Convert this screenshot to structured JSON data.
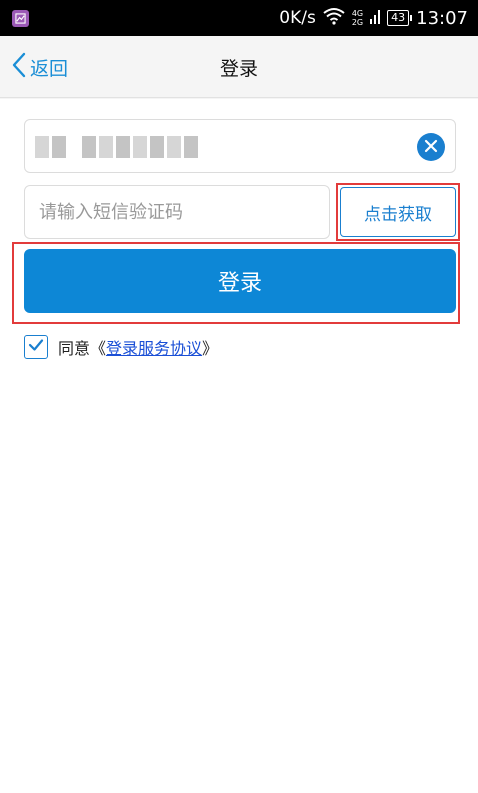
{
  "status_bar": {
    "net_speed": "0K/s",
    "net_type_top": "4G",
    "net_type_bottom": "2G",
    "battery": "43",
    "time": "13:07"
  },
  "header": {
    "back_label": "返回",
    "title": "登录"
  },
  "form": {
    "sms_placeholder": "请输入短信验证码",
    "get_code_label": "点击获取",
    "login_label": "登录",
    "agree_prefix": "同意《",
    "agreement_link": "登录服务协议",
    "agree_suffix": "》",
    "agree_checked": true
  },
  "colors": {
    "accent": "#0d87d6",
    "highlight": "#e23b3b"
  }
}
